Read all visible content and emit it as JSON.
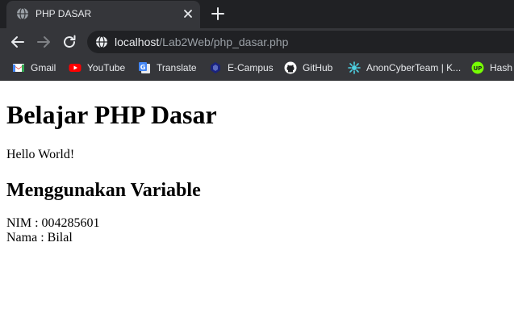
{
  "browser": {
    "tab": {
      "title": "PHP DASAR",
      "favicon": "globe-icon"
    },
    "address_bar": {
      "host": "localhost",
      "path": "/Lab2Web/php_dasar.php"
    },
    "bookmarks": [
      {
        "label": "Gmail",
        "icon": "gmail-icon"
      },
      {
        "label": "YouTube",
        "icon": "youtube-icon"
      },
      {
        "label": "Translate",
        "icon": "translate-icon"
      },
      {
        "label": "E-Campus",
        "icon": "ecampus-icon"
      },
      {
        "label": "GitHub",
        "icon": "github-icon"
      },
      {
        "label": "AnonCyberTeam | K...",
        "icon": "anoncyberteam-icon"
      },
      {
        "label": "Hash",
        "icon": "hash-icon"
      }
    ],
    "colors": {
      "tabstrip": "#202124",
      "toolbar": "#35363a",
      "text": "#e8eaed",
      "muted": "#9aa0a6"
    }
  },
  "page": {
    "heading": "Belajar PHP Dasar",
    "hello": "Hello World!",
    "subheading": "Menggunakan Variable",
    "nim": "NIM : 004285601",
    "nama": "Nama : Bilal"
  }
}
